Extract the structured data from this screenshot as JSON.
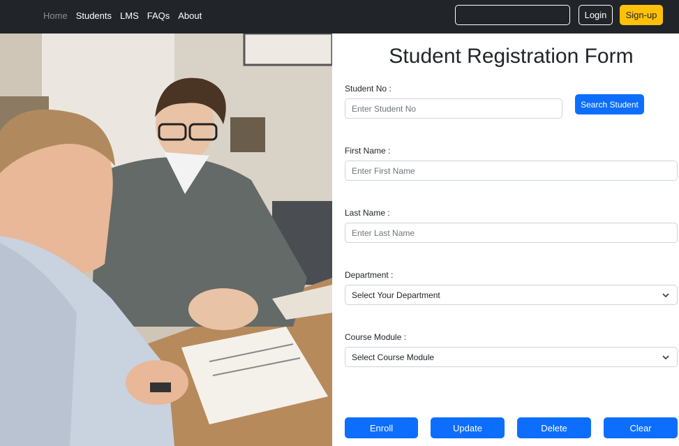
{
  "nav": {
    "links": [
      {
        "label": "Home",
        "muted": true
      },
      {
        "label": "Students"
      },
      {
        "label": "LMS"
      },
      {
        "label": "FAQs"
      },
      {
        "label": "About"
      }
    ],
    "search_value": "",
    "login_label": "Login",
    "signup_label": "Sign-up"
  },
  "form": {
    "title": "Student Registration Form",
    "student_no": {
      "label": "Student No :",
      "placeholder": "Enter Student No"
    },
    "search_button": "Search Student",
    "first_name": {
      "label": "First Name :",
      "placeholder": "Enter First Name"
    },
    "last_name": {
      "label": "Last Name :",
      "placeholder": "Enter Last Name"
    },
    "department": {
      "label": "Department :",
      "selected": "Select Your Department"
    },
    "course_module": {
      "label": "Course Module :",
      "selected": "Select Course Module"
    },
    "buttons": {
      "enroll": "Enroll",
      "update": "Update",
      "delete": "Delete",
      "clear": "Clear"
    }
  },
  "colors": {
    "navbar": "#212529",
    "primary": "#0d6efd",
    "warning": "#ffc107"
  }
}
